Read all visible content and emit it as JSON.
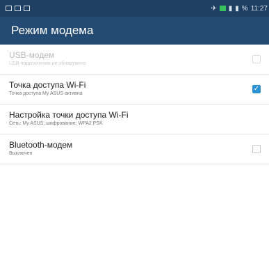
{
  "status_bar": {
    "time": "11:27",
    "battery_text": "%",
    "left_icons": [
      "image-icon",
      "message-icon",
      "notification-icon"
    ],
    "right_icons": [
      "nfc-icon",
      "wifi-icon",
      "signal-icon",
      "battery-icon"
    ]
  },
  "app_bar": {
    "title": "Режим модема"
  },
  "items": [
    {
      "title": "USB-модем",
      "subtitle": "USB-подключения не обнаружено",
      "checked": false,
      "enabled": false
    },
    {
      "title": "Точка доступа Wi-Fi",
      "subtitle": "Точка доступа My ASUS активна",
      "checked": true,
      "enabled": true
    },
    {
      "title": "Настройка точки доступа Wi-Fi",
      "subtitle": "Сеть: My ASUS; шифрование: WPA2 PSK",
      "enabled": true
    },
    {
      "title": "Bluetooth-модем",
      "subtitle": "Выключен",
      "checked": false,
      "enabled": true
    }
  ],
  "colors": {
    "status_bar": "#1f3f63",
    "app_bar": "#234b74",
    "accent": "#2d92d4"
  }
}
